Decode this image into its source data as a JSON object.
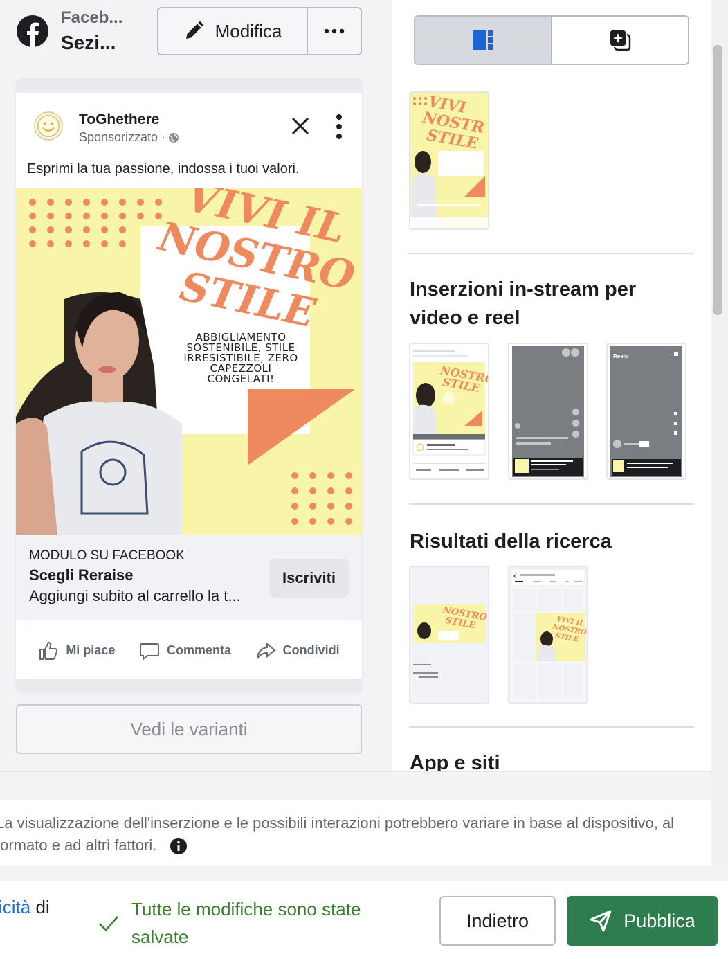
{
  "header": {
    "title": "Faceb...",
    "subtitle": "Sezi...",
    "edit_label": "Modifica"
  },
  "ad": {
    "page_name": "ToGhethere",
    "sponsored": "Sponsorizzato ·",
    "primary_text": "Esprimi la tua passione, indossa i tuoi valori.",
    "image_headline": [
      "VIVI IL",
      "NOSTRO",
      "STILE"
    ],
    "image_tagline": [
      "ABBIGLIAMENTO",
      "SOSTENIBILE, STILE",
      "IRRESISTIBILE, ZERO",
      "CAPEZZOLI",
      "CONGELATI!"
    ],
    "form_label": "MODULO SU FACEBOOK",
    "form_title": "Scegli Reraise",
    "form_desc": "Aggiungi subito al carrello la t...",
    "cta": "Iscriviti",
    "actions": {
      "like": "Mi piace",
      "comment": "Commenta",
      "share": "Condividi"
    }
  },
  "variants_label": "Vedi le varianti",
  "placements": {
    "instream_title": "Inserzioni in-stream per video e reel",
    "search_title": "Risultati della ricerca",
    "apps_title": "App e siti",
    "reels_label": "Reels"
  },
  "note": "La visualizzazione dell'inserzione e le possibili interazioni potrebbero variare in base al dispositivo, al formato e ad altri fattori.",
  "footer": {
    "left_link": "icità",
    "left_rest": " di",
    "saved": "Tutte le modifiche sono state salvate",
    "back": "Indietro",
    "publish": "Pubblica"
  },
  "colors": {
    "accent_orange": "#ef8a5f",
    "ad_yellow": "#f9f5a8",
    "publish_green": "#2e7d4f",
    "saved_green": "#3a7f2c",
    "link_blue": "#216fdb"
  }
}
